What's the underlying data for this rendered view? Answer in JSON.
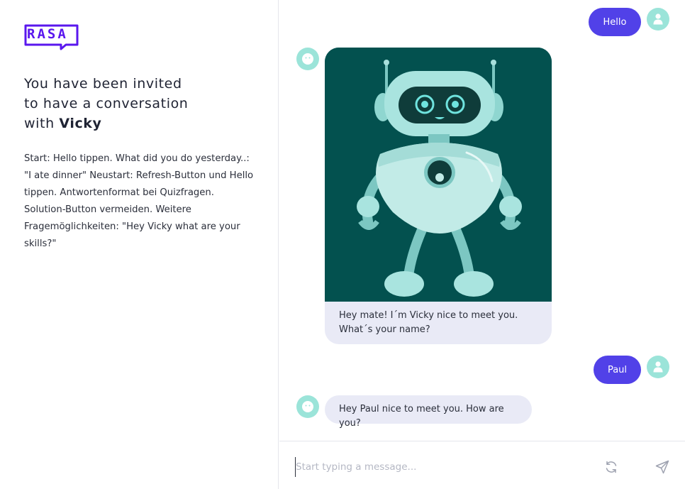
{
  "brand": {
    "logo_text": "RASA",
    "color": "#5a17ee"
  },
  "intro": {
    "line1": "You have been invited",
    "line2": "to have a conversation",
    "line3_prefix": "with",
    "bot_name": "Vicky"
  },
  "instructions": "Start: Hello tippen. What did you do yesterday..: \"I ate dinner\" Neustart: Refresh-Button und Hello tippen. Antwortenformat bei Quizfragen. Solution-Button vermeiden. Weitere Fragemöglichkeiten: \"Hey Vicky what are your skills?\"",
  "messages": [
    {
      "sender": "user",
      "text": "Hello"
    },
    {
      "sender": "bot",
      "type": "image-card",
      "image": "robot-illustration",
      "text": "Hey mate! I´m Vicky nice to meet you. What´s your name?"
    },
    {
      "sender": "user",
      "text": "Paul"
    },
    {
      "sender": "bot",
      "text": "Hey Paul nice to meet you. How are you?"
    }
  ],
  "composer": {
    "placeholder": "Start typing a message...",
    "value": "",
    "refresh_icon": "refresh-icon",
    "send_icon": "send-icon"
  },
  "colors": {
    "user_bubble": "#5141e8",
    "bot_bubble": "#e9eaf6",
    "avatar_bg": "#9be4d9",
    "image_bg": "#03514f"
  }
}
